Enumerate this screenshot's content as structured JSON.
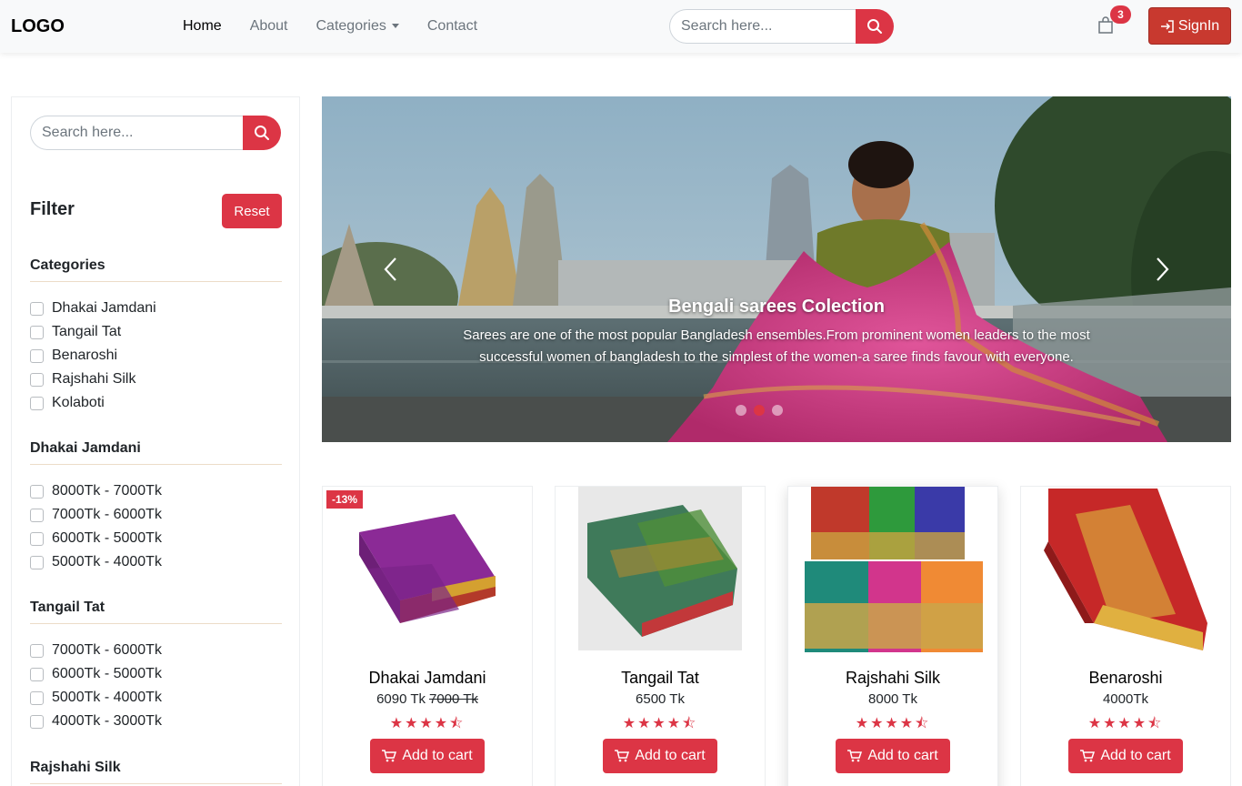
{
  "navbar": {
    "logo": "LOGO",
    "links": [
      {
        "label": "Home",
        "active": true
      },
      {
        "label": "About",
        "active": false
      },
      {
        "label": "Categories",
        "active": false,
        "dropdown": true
      },
      {
        "label": "Contact",
        "active": false
      }
    ],
    "search_placeholder": "Search here...",
    "cart_count": "3",
    "signin_label": "SignIn"
  },
  "sidebar": {
    "search_placeholder": "Search here...",
    "filter_title": "Filter",
    "reset_label": "Reset",
    "sections": [
      {
        "title": "Categories",
        "options": [
          "Dhakai Jamdani",
          "Tangail Tat",
          "Benaroshi",
          "Rajshahi Silk",
          "Kolaboti"
        ]
      },
      {
        "title": "Dhakai Jamdani",
        "options": [
          "8000Tk - 7000Tk",
          "7000Tk - 6000Tk",
          "6000Tk - 5000Tk",
          "5000Tk - 4000Tk"
        ]
      },
      {
        "title": "Tangail Tat",
        "options": [
          "7000Tk - 6000Tk",
          "6000Tk - 5000Tk",
          "5000Tk - 4000Tk",
          "4000Tk - 3000Tk"
        ]
      },
      {
        "title": "Rajshahi Silk",
        "options": []
      }
    ]
  },
  "carousel": {
    "title": "Bengali sarees Colection",
    "text": "Sarees are one of the most popular Bangladesh ensembles.From prominent women leaders to the most successful women of bangladesh to the simplest of the women-a saree finds favour with everyone.",
    "slides": 3,
    "active_slide": 1
  },
  "products": [
    {
      "name": "Dhakai Jamdani",
      "price": "6090 Tk",
      "old_price": "7000 Tk",
      "discount": "-13%",
      "rating": 4.5,
      "stars": "★★★★⯪",
      "button": "Add to cart"
    },
    {
      "name": "Tangail Tat",
      "price": "6500 Tk",
      "old_price": "",
      "discount": "",
      "rating": 4.5,
      "stars": "★★★★⯪",
      "button": "Add to cart"
    },
    {
      "name": "Rajshahi Silk",
      "price": "8000 Tk",
      "old_price": "",
      "discount": "",
      "rating": 4.5,
      "stars": "★★★★⯪",
      "button": "Add to cart"
    },
    {
      "name": "Benaroshi",
      "price": "4000Tk",
      "old_price": "",
      "discount": "",
      "rating": 4.5,
      "stars": "★★★★⯪",
      "button": "Add to cart"
    }
  ],
  "colors": {
    "accent": "#dc3545",
    "navbar_bg": "#f8f9fa"
  }
}
